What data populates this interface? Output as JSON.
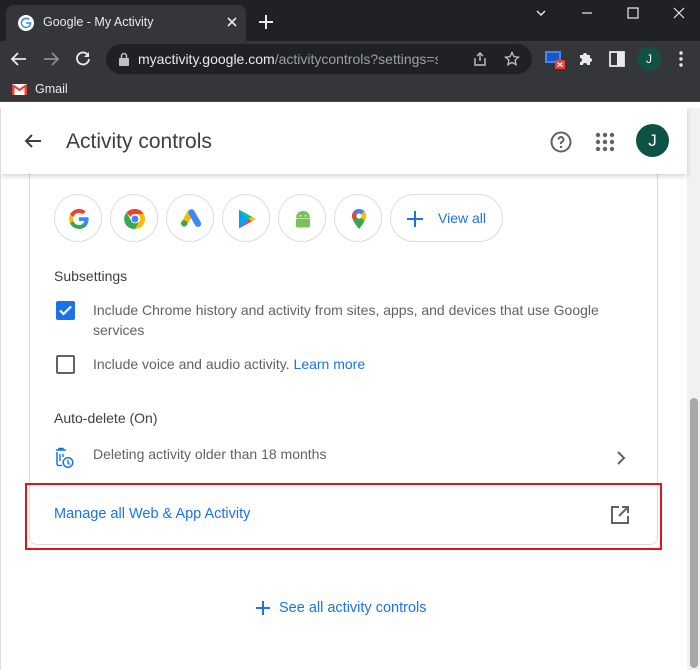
{
  "browser": {
    "tab_title": "Google - My Activity",
    "url_host": "myactivity.google.com",
    "url_path": "/activitycontrols?settings=s...",
    "profile_initial": "J",
    "bookmark_label": "Gmail"
  },
  "header": {
    "title": "Activity controls",
    "avatar_initial": "J"
  },
  "apps_row": {
    "icons": [
      "google-icon",
      "chrome-icon",
      "google-ads-icon",
      "play-store-icon",
      "android-icon",
      "maps-icon"
    ],
    "view_all_label": "View all"
  },
  "subsettings": {
    "heading": "Subsettings",
    "items": [
      {
        "checked": true,
        "text": "Include Chrome history and activity from sites, apps, and devices that use Google services"
      },
      {
        "checked": false,
        "text": "Include voice and audio activity.",
        "link": "Learn more"
      }
    ]
  },
  "auto_delete": {
    "heading": "Auto-delete (On)",
    "text": "Deleting activity older than 18 months"
  },
  "manage": {
    "label": "Manage all Web & App Activity"
  },
  "footer": {
    "see_all_label": "See all activity controls"
  },
  "colors": {
    "accent": "#1a73e8",
    "highlight": "#e3121b",
    "avatar": "#0d5245"
  }
}
